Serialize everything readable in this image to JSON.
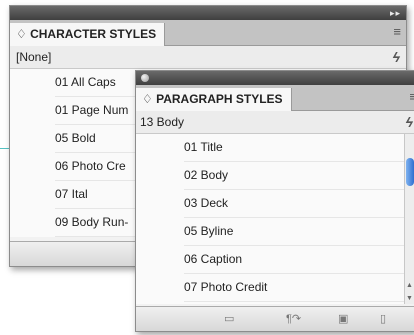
{
  "character_panel": {
    "tab_label": "♢ CHARACTER STYLES",
    "current_style": "[None]",
    "items": [
      "01 All Caps",
      "01 Page Num",
      "05 Bold",
      "06 Photo Cre",
      "07 Ital",
      "09 Body Run-"
    ]
  },
  "paragraph_panel": {
    "tab_label": "♢ PARAGRAPH STYLES",
    "current_style": "13 Body",
    "items": [
      "01 Title",
      "02 Body",
      "03 Deck",
      "05 Byline",
      "06 Caption",
      "07 Photo Credit"
    ]
  },
  "icons": {
    "panel_menu": "≡",
    "clear_overrides": "ϟ",
    "collapse": "▸▸"
  },
  "colors": {
    "guide_line": "#55c2c2",
    "scroll_thumb": "#2f6fd0"
  }
}
